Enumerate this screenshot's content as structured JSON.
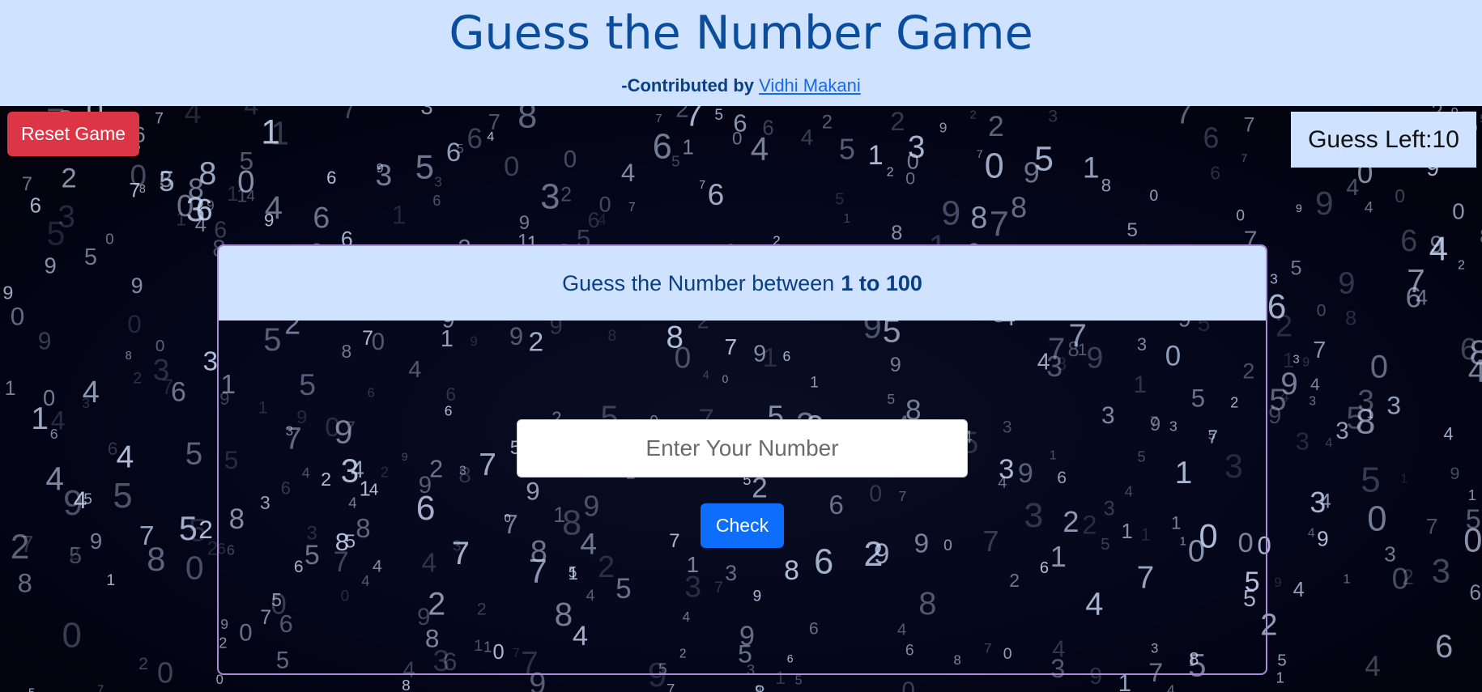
{
  "header": {
    "title": "Guess the Number Game",
    "credit_prefix": "-Contributed by ",
    "credit_name": "Vidhi Makani"
  },
  "controls": {
    "reset_label": "Reset Game",
    "guess_left_label": "Guess Left: ",
    "guess_left_value": "10"
  },
  "card": {
    "prompt": "Guess the Number between",
    "range": "1 to 100"
  },
  "input": {
    "placeholder": "Enter Your Number",
    "value": ""
  },
  "check_label": "Check",
  "colors": {
    "header_bg": "#cfe2ff",
    "title": "#0a4c9e",
    "reset": "#dc3545",
    "check": "#0d6efd",
    "card_border": "#a98bd6"
  }
}
